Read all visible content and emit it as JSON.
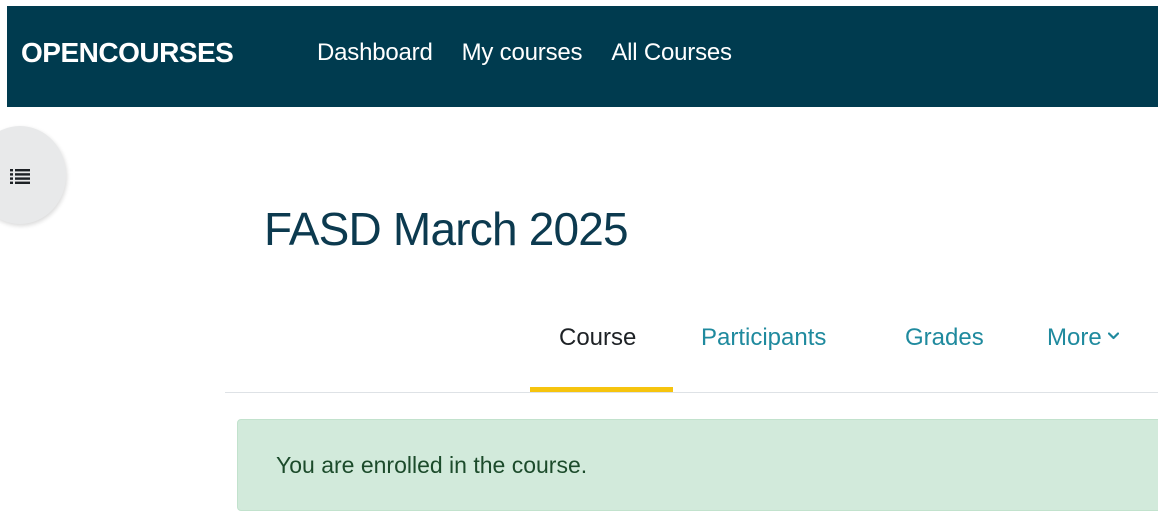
{
  "navbar": {
    "brand": "OPENCOURSES",
    "links": [
      "Dashboard",
      "My courses",
      "All Courses"
    ],
    "background_color": "#003b4f"
  },
  "drawer": {
    "icon": "list-icon"
  },
  "page": {
    "title": "FASD March 2025"
  },
  "tabs": {
    "items": [
      {
        "label": "Course",
        "active": true
      },
      {
        "label": "Participants",
        "active": false
      },
      {
        "label": "Grades",
        "active": false
      },
      {
        "label": "More",
        "active": false,
        "icon": "chevron-down-icon"
      }
    ],
    "active_indicator_color": "#f6c40e",
    "link_color": "#1f8a9e"
  },
  "alert": {
    "message": "You are enrolled in the course.",
    "type": "success",
    "background_color": "#d2eadb"
  }
}
